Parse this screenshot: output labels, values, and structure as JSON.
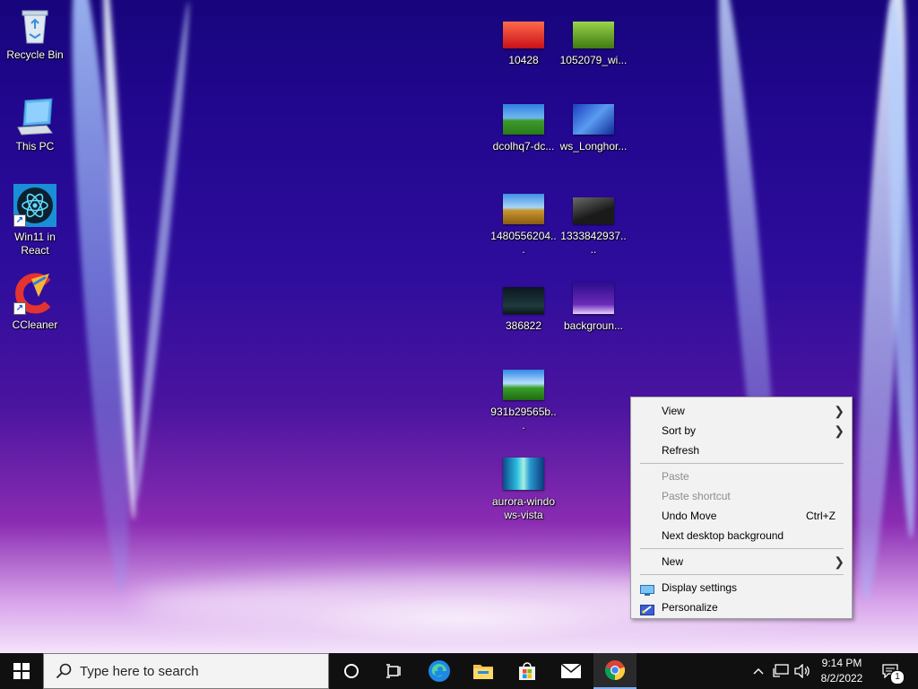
{
  "desktop": {
    "icons_left": [
      {
        "label": "Recycle Bin",
        "icon": "recycle-bin-icon"
      },
      {
        "label": "This PC",
        "icon": "computer-icon"
      },
      {
        "label": "Win11 in React",
        "icon": "react-icon"
      },
      {
        "label": "CCleaner",
        "icon": "ccleaner-icon"
      }
    ],
    "files": [
      {
        "label": "10428"
      },
      {
        "label": "1052079_wi..."
      },
      {
        "label": "dcolhq7-dc..."
      },
      {
        "label": "ws_Longhor..."
      },
      {
        "label": "1480556204..."
      },
      {
        "label": "1333842937...."
      },
      {
        "label": "386822"
      },
      {
        "label": "backgroun..."
      },
      {
        "label": "931b29565b..."
      },
      {
        "label": "aurora-windo ws-vista"
      }
    ]
  },
  "context_menu": {
    "view": "View",
    "sort_by": "Sort by",
    "refresh": "Refresh",
    "paste": "Paste",
    "paste_shortcut": "Paste shortcut",
    "undo_move": "Undo Move",
    "undo_move_shortcut": "Ctrl+Z",
    "next_background": "Next desktop background",
    "new": "New",
    "display_settings": "Display settings",
    "personalize": "Personalize"
  },
  "taskbar": {
    "search_placeholder": "Type here to search",
    "time": "9:14 PM",
    "date": "8/2/2022",
    "notification_count": "1",
    "apps": [
      "task-view-icon",
      "edge-icon",
      "file-explorer-icon",
      "store-icon",
      "mail-icon",
      "chrome-icon"
    ]
  },
  "colors": {
    "taskbar": "#101010",
    "menu_bg": "#f2f2f2",
    "wallpaper_primary": "#22078f"
  }
}
